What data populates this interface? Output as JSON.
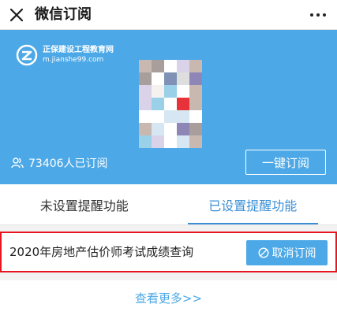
{
  "topbar": {
    "title": "微信订阅",
    "close_icon": "close-icon",
    "more_icon": "more-dots-icon"
  },
  "hero": {
    "background_color": "#4ca8e6",
    "logo": {
      "name": "正保建设工程教育网",
      "url": "m.jianshe99.com"
    },
    "subscriber_count": "73406人已订阅",
    "subscribe_button": "一键订阅"
  },
  "tabs": [
    {
      "label": "未设置提醒功能",
      "active": false
    },
    {
      "label": "已设置提醒功能",
      "active": true
    }
  ],
  "items": [
    {
      "name": "2020年房地产估价师考试成绩查询",
      "action": "取消订阅"
    }
  ],
  "footer": {
    "more_link": "查看更多>>"
  },
  "colors": {
    "accent": "#4ca8e6",
    "active_tab": "#3b8fd6",
    "highlight_border": "#e5171f"
  }
}
